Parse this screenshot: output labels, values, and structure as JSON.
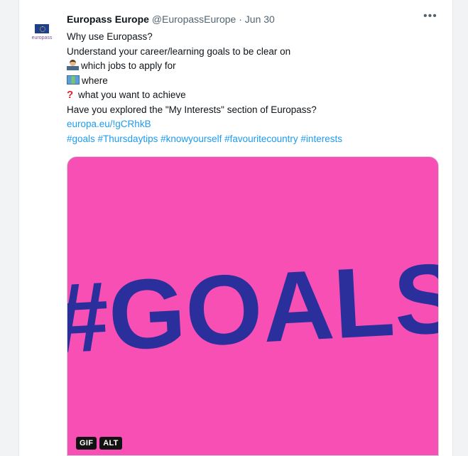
{
  "tweet": {
    "author_name": "Europass Europe",
    "author_handle": "@EuropassEurope",
    "separator": "·",
    "date": "Jun 30",
    "avatar_text": "europass",
    "more_icon": "more-horizontal-icon",
    "lines": [
      "Why use Europass?",
      "Understand your career/learning goals to be clear on",
      "which jobs to apply for",
      "where",
      "what you want to achieve",
      "Have you explored the \"My Interests\" section of Europass?"
    ],
    "link": "europa.eu/!gCRhkB",
    "hashtags": "#goals #Thursdaytips #knowyourself #favouritecountry #interests",
    "emojis": [
      "technologist-emoji",
      "world-map-emoji",
      "red-question-mark-emoji"
    ]
  },
  "media": {
    "gif_text": "#GOALS",
    "background_color": "#f84fb5",
    "text_color": "#2a2f9c",
    "badge_gif": "GIF",
    "badge_alt": "ALT"
  }
}
